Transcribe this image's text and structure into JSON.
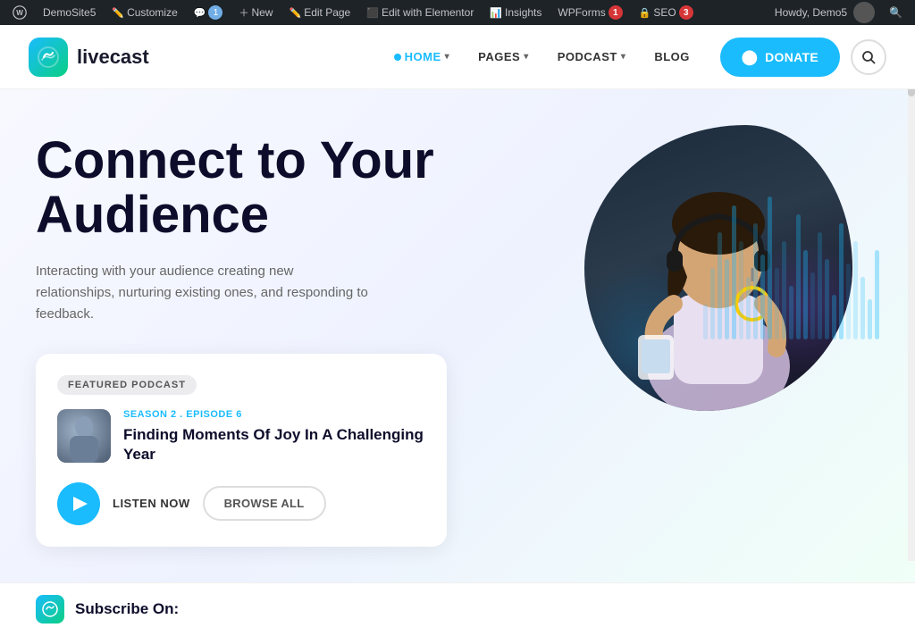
{
  "adminBar": {
    "siteName": "DemoSite5",
    "customize": "Customize",
    "comments": "1",
    "newLabel": "New",
    "editPage": "Edit Page",
    "editElementor": "Edit with Elementor",
    "insights": "Insights",
    "wpforms": "WPForms",
    "wpformsBadge": "1",
    "seo": "SEO",
    "seoBadge": "3",
    "howdy": "Howdy, Demo5"
  },
  "nav": {
    "logoText": "livecast",
    "links": [
      {
        "label": "HOME",
        "active": true,
        "hasDot": true,
        "hasChevron": true
      },
      {
        "label": "PAGES",
        "active": false,
        "hasDot": false,
        "hasChevron": true
      },
      {
        "label": "PODCAST",
        "active": false,
        "hasDot": false,
        "hasChevron": true
      },
      {
        "label": "BLOG",
        "active": false,
        "hasDot": false,
        "hasChevron": false
      }
    ],
    "donateIcon": "♥",
    "donateLabel": "DONATE",
    "searchIcon": "🔍"
  },
  "hero": {
    "title": "Connect to Your Audience",
    "subtitle": "Interacting with your audience creating new relationships, nurturing existing ones, and responding to feedback.",
    "featuredCard": {
      "badgeLabel": "FEATURED PODCAST",
      "episodeLabel": "SEASON 2 . EPISODE 6",
      "episodeTitle": "Finding Moments Of Joy In A Challenging Year",
      "listenNowLabel": "LISTEN NOW",
      "browseAllLabel": "BROWSE ALL"
    }
  },
  "subscribeBar": {
    "label": "Subscribe On:"
  },
  "waveform": {
    "heights": [
      40,
      80,
      120,
      90,
      150,
      110,
      70,
      130,
      95,
      160,
      80,
      110,
      60,
      140,
      100,
      75,
      120,
      90,
      50,
      130,
      85,
      110,
      70,
      45,
      100
    ]
  }
}
